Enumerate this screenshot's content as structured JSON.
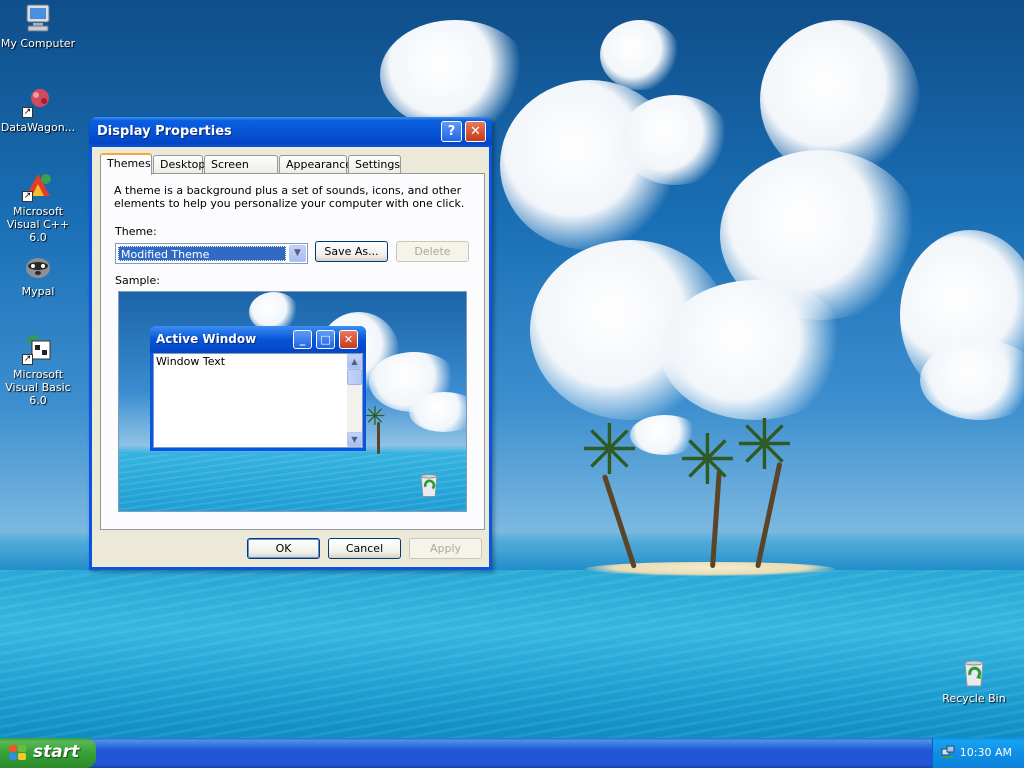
{
  "desktop": {
    "icons": [
      {
        "label": "My Computer",
        "glyph": "computer-icon"
      },
      {
        "label": "DataWagon...",
        "glyph": "datawagon-icon"
      },
      {
        "label": "Microsoft Visual C++ 6.0",
        "glyph": "visual-cpp-icon"
      },
      {
        "label": "Mypal",
        "glyph": "mypal-icon"
      },
      {
        "label": "Microsoft Visual Basic 6.0",
        "glyph": "visual-basic-icon"
      },
      {
        "label": "Recycle Bin",
        "glyph": "recycle-bin-icon"
      }
    ]
  },
  "dialog": {
    "title": "Display Properties",
    "help_glyph": "?",
    "close_glyph": "✕",
    "tabs": [
      {
        "label": "Themes",
        "active": true
      },
      {
        "label": "Desktop"
      },
      {
        "label": "Screen Saver"
      },
      {
        "label": "Appearance"
      },
      {
        "label": "Settings"
      }
    ],
    "description": "A theme is a background plus a set of sounds, icons, and other elements to help you personalize your computer with one click.",
    "theme_label": "Theme:",
    "theme_value": "Modified Theme",
    "save_as_label": "Save As...",
    "delete_label": "Delete",
    "sample_label": "Sample:",
    "sample_window": {
      "title": "Active Window",
      "body_text": "Window Text"
    },
    "ok_label": "OK",
    "cancel_label": "Cancel",
    "apply_label": "Apply"
  },
  "taskbar": {
    "start_label": "start",
    "clock": "10:30 AM"
  },
  "colors": {
    "accent": "#0a54e3",
    "start_green": "#36a136",
    "taskbar_blue": "#2157d7"
  }
}
